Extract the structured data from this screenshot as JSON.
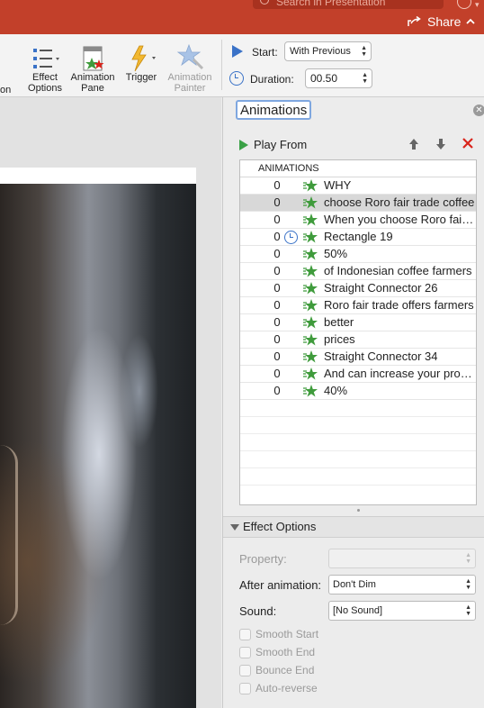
{
  "titlebar": {
    "search_placeholder": "Search in Presentation",
    "share_label": "Share"
  },
  "ribbon": {
    "edge_text": "on",
    "effect_options_label": "Effect Options",
    "animation_pane_label": "Animation Pane",
    "trigger_label": "Trigger",
    "animation_painter_label": "Animation Painter",
    "start_label": "Start:",
    "start_value": "With Previous",
    "duration_label": "Duration:",
    "duration_value": "00.50"
  },
  "pane": {
    "title": "Animations",
    "play_from_label": "Play From",
    "list_header": "ANIMATIONS",
    "items": [
      {
        "num": "0",
        "name": "WHY",
        "selected": false,
        "clock": false
      },
      {
        "num": "0",
        "name": "choose Roro fair trade coffee",
        "selected": true,
        "clock": false
      },
      {
        "num": "0",
        "name": "When you choose Roro fair trade",
        "selected": false,
        "clock": false
      },
      {
        "num": "0",
        "name": "Rectangle 19",
        "selected": false,
        "clock": true
      },
      {
        "num": "0",
        "name": "50%",
        "selected": false,
        "clock": false
      },
      {
        "num": "0",
        "name": "of Indonesian coffee farmers",
        "selected": false,
        "clock": false
      },
      {
        "num": "0",
        "name": "Straight Connector 26",
        "selected": false,
        "clock": false
      },
      {
        "num": "0",
        "name": "Roro fair trade offers farmers",
        "selected": false,
        "clock": false
      },
      {
        "num": "0",
        "name": "better",
        "selected": false,
        "clock": false
      },
      {
        "num": "0",
        "name": "prices",
        "selected": false,
        "clock": false
      },
      {
        "num": "0",
        "name": "Straight Connector 34",
        "selected": false,
        "clock": false
      },
      {
        "num": "0",
        "name": "And can increase your profits",
        "selected": false,
        "clock": false
      },
      {
        "num": "0",
        "name": "40%",
        "selected": false,
        "clock": false
      }
    ],
    "effect_options": {
      "header": "Effect Options",
      "property_label": "Property:",
      "property_value": "",
      "after_animation_label": "After animation:",
      "after_animation_value": "Don't Dim",
      "sound_label": "Sound:",
      "sound_value": "[No Sound]",
      "smooth_start_label": "Smooth Start",
      "smooth_end_label": "Smooth End",
      "bounce_end_label": "Bounce End",
      "auto_reverse_label": "Auto-reverse"
    }
  },
  "colors": {
    "titlebar": "#c2402a",
    "play_green": "#3aa146",
    "delete_red": "#d9241b",
    "clock_blue": "#3a72c7",
    "star_green": "#3f9b3c"
  }
}
